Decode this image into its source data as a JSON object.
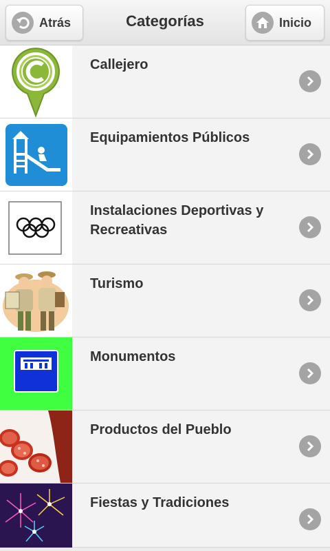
{
  "header": {
    "back_label": "Atrás",
    "title": "Categorías",
    "home_label": "Inicio"
  },
  "categories": [
    {
      "label": "Callejero",
      "icon": "map-pin-c-icon"
    },
    {
      "label": "Equipamientos Públicos",
      "icon": "playground-slide-icon"
    },
    {
      "label": "Instalaciones Deportivas y Recreativas",
      "icon": "olympic-rings-icon"
    },
    {
      "label": "Turismo",
      "icon": "hikers-illustration-icon"
    },
    {
      "label": "Monumentos",
      "icon": "monument-sign-icon"
    },
    {
      "label": "Productos del Pueblo",
      "icon": "chorizo-photo-icon"
    },
    {
      "label": "Fiestas y Tradiciones",
      "icon": "fireworks-photo-icon"
    }
  ]
}
